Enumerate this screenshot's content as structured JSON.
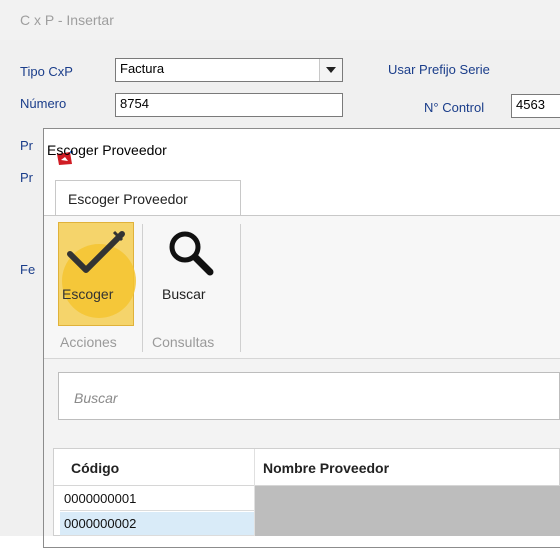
{
  "background_window": {
    "title": "C x P - Insertar",
    "tipo_label": "Tipo CxP",
    "tipo_value": "Factura",
    "usar_prefijo_label": "Usar Prefijo Serie",
    "numero_label": "Número",
    "numero_value": "8754",
    "control_label": "N° Control",
    "control_value": "4563",
    "partial_labels": [
      "Pr",
      "Pr",
      "Fe"
    ]
  },
  "dialog": {
    "title": "Escoger Proveedor",
    "tab_label": "Escoger Proveedor",
    "ribbon": {
      "escoger_label": "Escoger",
      "buscar_label": "Buscar",
      "group_acciones": "Acciones",
      "group_consultas": "Consultas"
    },
    "search": {
      "placeholder": "Buscar"
    },
    "table": {
      "columns": [
        "Código",
        "Nombre Proveedor"
      ],
      "rows": [
        {
          "codigo": "0000000001"
        },
        {
          "codigo": "0000000002"
        }
      ]
    }
  },
  "colors": {
    "highlight": "#f4c430",
    "label_blue": "#1a3d8a",
    "active_button": "#f5d46b"
  },
  "icons": {
    "dialog": "app-logo-icon",
    "escoger": "checkmark-pen-icon",
    "buscar": "magnifier-icon",
    "dropdown": "chevron-down-icon"
  }
}
